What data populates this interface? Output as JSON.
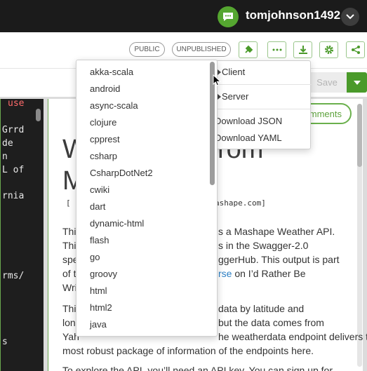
{
  "topbar": {
    "username": "tomjohnson1492",
    "user_icon": "chat-bubble-icon",
    "toggle_icon": "chevron-down-icon",
    "brand_color": "#55a630"
  },
  "toolbar": {
    "public_label": "PUBLIC",
    "unpublished_label": "UNPUBLISHED",
    "buttons": [
      "plug-icon",
      "more-icon",
      "download-icon",
      "gear-icon",
      "share-icon"
    ],
    "save_label": "Save"
  },
  "editor": {
    "lines": [
      {
        "text": "use",
        "style": "keyword"
      },
      {
        "text": "Grrd",
        "style": "plain"
      },
      {
        "text": "de",
        "style": "plain"
      },
      {
        "text": "n",
        "style": "plain"
      },
      {
        "text": "L of",
        "style": "plain"
      },
      {
        "text": "rnia",
        "style": "plain"
      },
      {
        "text": "rms/",
        "style": "plain"
      },
      {
        "text": "s",
        "style": "plain"
      }
    ]
  },
  "preview": {
    "comments_label": "mments",
    "title_fragments": [
      "W",
      "rom",
      "M"
    ],
    "host_fragments": [
      "[",
      "ashape.com]"
    ],
    "para1": [
      {
        "pre": "Thi",
        "post": "s a Mashape Weather API."
      },
      {
        "pre": "Thi",
        "post": "s in the Swagger-2.0"
      },
      {
        "pre": "spe",
        "post": "ggerHub. This output is part"
      },
      {
        "pre": "of t",
        "link": "rse",
        "post": " on I’d Rather Be"
      },
      {
        "pre": "Wri",
        "post": ""
      }
    ],
    "para2": [
      {
        "pre": "Thi",
        "post": "data by latitude and"
      },
      {
        "pre": "lon",
        "post": "but the data comes from"
      },
      {
        "pre": "Yah",
        "post": "he weatherdata endpoint delivers the"
      },
      {
        "pre": "most robust package of information of the endpoints here.",
        "post": ""
      }
    ],
    "para3": "To explore the API, you’ll need an API key. You can sign up for"
  },
  "language_menu": {
    "items": [
      "akka-scala",
      "android",
      "async-scala",
      "clojure",
      "cpprest",
      "csharp",
      "CsharpDotNet2",
      "cwiki",
      "dart",
      "dynamic-html",
      "flash",
      "go",
      "groovy",
      "html",
      "html2",
      "java"
    ]
  },
  "generate_menu": {
    "client_label": "Client",
    "server_label": "Server",
    "download_json_label": "Download JSON",
    "download_yaml_label": "Download YAML"
  }
}
